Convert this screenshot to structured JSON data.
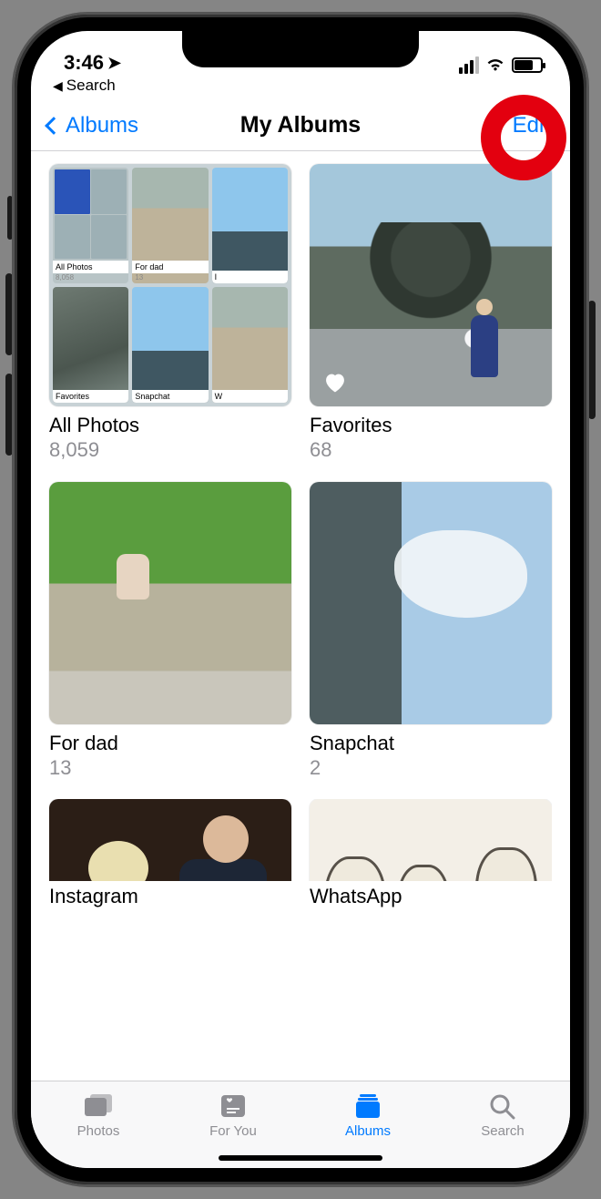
{
  "status": {
    "time": "3:46",
    "location_arrow": "➤",
    "breadcrumb_prefix": "◀",
    "breadcrumb_label": "Search"
  },
  "nav": {
    "back_label": "Albums",
    "title": "My Albums",
    "edit_label": "Edit"
  },
  "albums": [
    {
      "title": "All Photos",
      "count": "8,059",
      "collage": [
        {
          "label": "All Photos",
          "sub": "8,058"
        },
        {
          "label": "For dad",
          "sub": "13"
        },
        {
          "label": "I",
          "sub": ""
        },
        {
          "label": "Favorites",
          "sub": ""
        },
        {
          "label": "Snapchat",
          "sub": ""
        },
        {
          "label": "W",
          "sub": ""
        }
      ]
    },
    {
      "title": "Favorites",
      "count": "68"
    },
    {
      "title": "For dad",
      "count": "13"
    },
    {
      "title": "Snapchat",
      "count": "2"
    },
    {
      "title": "Instagram",
      "count": ""
    },
    {
      "title": "WhatsApp",
      "count": ""
    }
  ],
  "tabs": [
    {
      "label": "Photos"
    },
    {
      "label": "For You"
    },
    {
      "label": "Albums"
    },
    {
      "label": "Search"
    }
  ],
  "active_tab_index": 2
}
